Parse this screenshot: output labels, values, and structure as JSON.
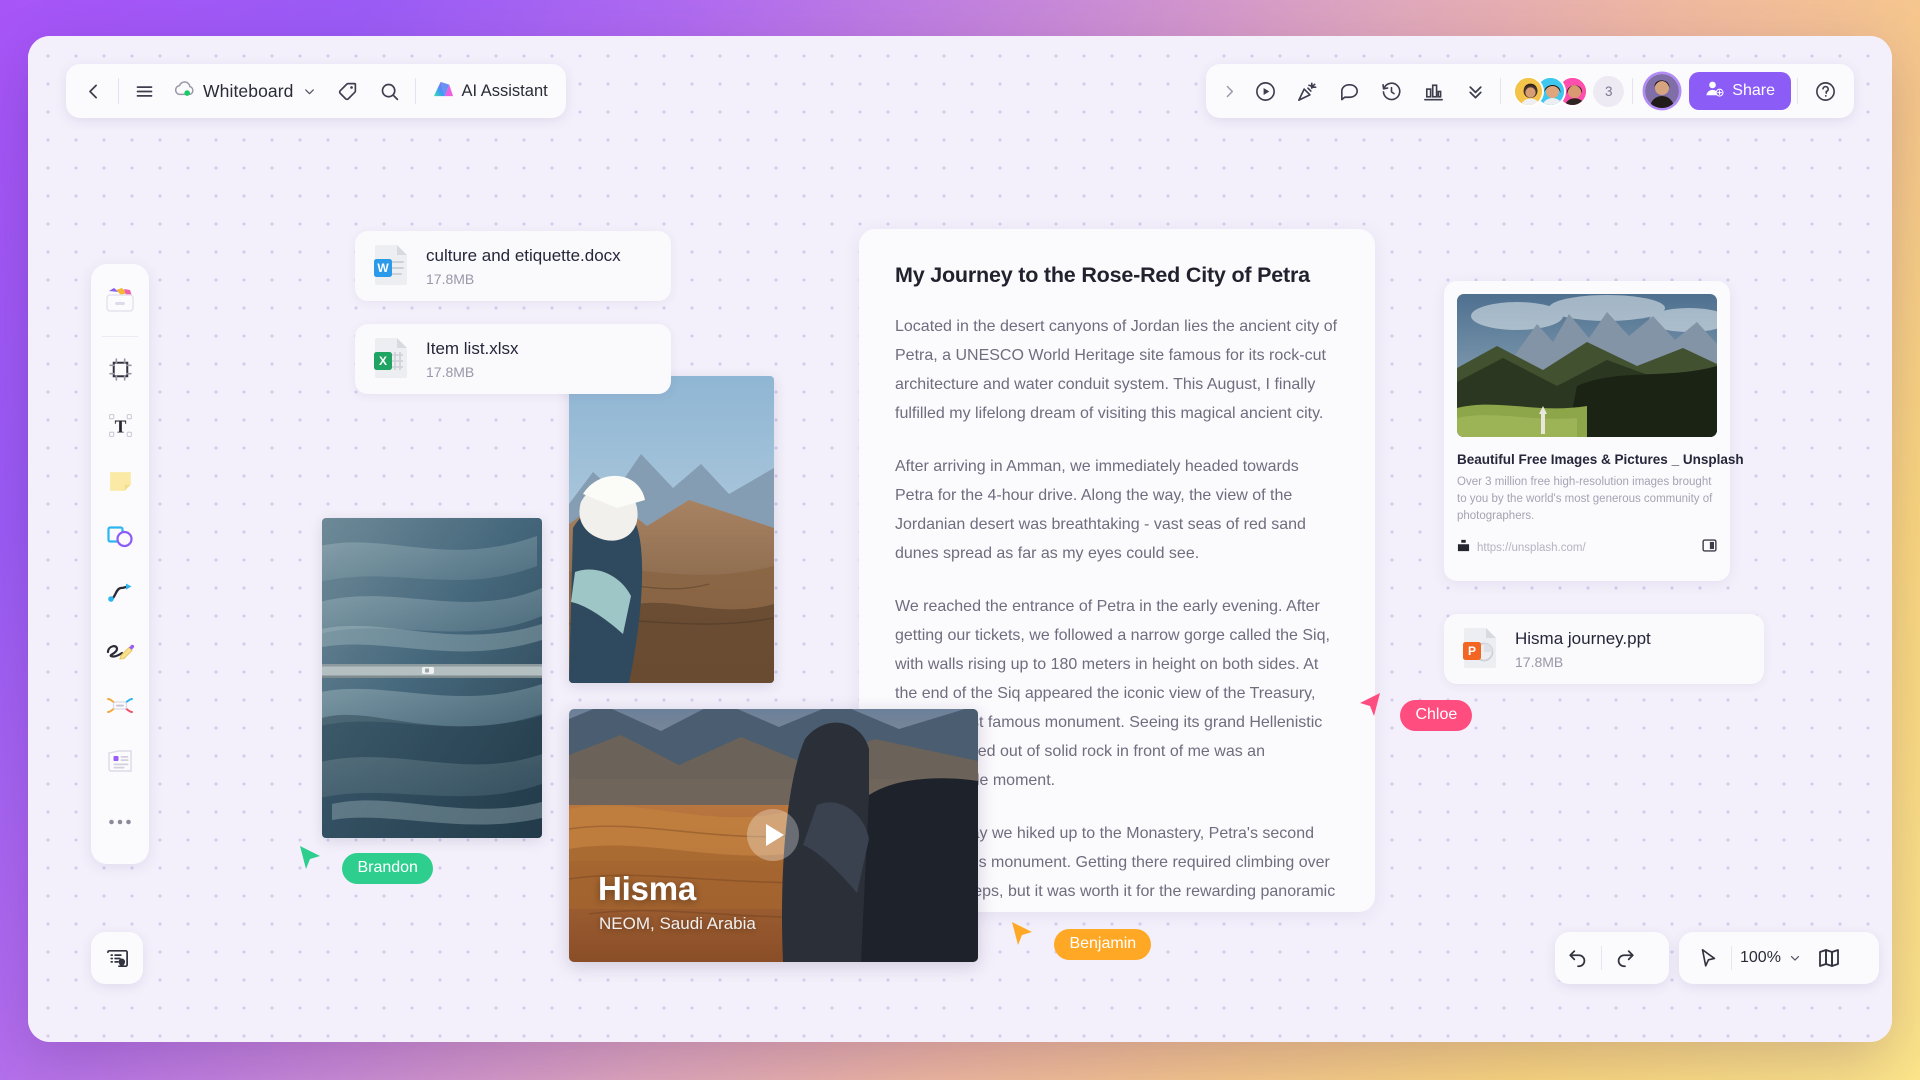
{
  "app": {
    "background_gradient": [
      "#a855f7",
      "#e0a8bd",
      "#fde68a"
    ],
    "canvas_bg": "#f3f0fb"
  },
  "topbar_left": {
    "back_icon": "chevron-left-icon",
    "menu_icon": "hamburger-menu-icon",
    "doc_icon": "cloud-synced-icon",
    "doc_title": "Whiteboard",
    "doc_caret": "chevron-down-icon",
    "tag_icon": "tag-icon",
    "search_icon": "search-icon",
    "ai_icon": "ai-sparkle-icon",
    "ai_label": "AI Assistant"
  },
  "topbar_right": {
    "expand_icon": "chevron-right-icon",
    "icons": [
      {
        "name": "present-play-icon"
      },
      {
        "name": "party-popper-icon"
      },
      {
        "name": "comment-bubble-icon"
      },
      {
        "name": "timer-icon"
      },
      {
        "name": "vote-chart-icon"
      },
      {
        "name": "chevron-double-down-icon"
      }
    ],
    "collaborators": [
      {
        "name": "collaborator-avatar-1",
        "ring": "#f5c242"
      },
      {
        "name": "collaborator-avatar-2",
        "ring": "#35c8f0"
      },
      {
        "name": "collaborator-avatar-3",
        "ring": "#ff3ea5"
      }
    ],
    "overflow_count": "3",
    "me_avatar": "current-user-avatar",
    "share_label": "Share",
    "share_icon": "add-person-icon",
    "share_color": "#8b5cf6",
    "help_icon": "help-circle-icon"
  },
  "tool_rail": [
    {
      "name": "tool-template-gallery",
      "icon": "template-tray-icon"
    },
    {
      "name": "tool-frame",
      "icon": "frame-icon"
    },
    {
      "name": "tool-text",
      "icon": "text-t-icon"
    },
    {
      "name": "tool-sticky-note",
      "icon": "sticky-note-icon"
    },
    {
      "name": "tool-shapes",
      "icon": "shapes-icon"
    },
    {
      "name": "tool-connector",
      "icon": "curve-arrow-icon"
    },
    {
      "name": "tool-pen",
      "icon": "pen-scribble-icon"
    },
    {
      "name": "tool-mindmap",
      "icon": "mindmap-icon"
    },
    {
      "name": "tool-document",
      "icon": "document-card-icon"
    },
    {
      "name": "tool-more",
      "icon": "more-dots-icon"
    }
  ],
  "canvas": {
    "file_cards": [
      {
        "name": "culture and etiquette.docx",
        "size": "17.8MB",
        "icon": "word-file-icon",
        "color": "#2b7cd3"
      },
      {
        "name": "Item list.xlsx",
        "size": "17.8MB",
        "icon": "excel-file-icon",
        "color": "#1fa463"
      },
      {
        "name": "Hisma journey.ppt",
        "size": "17.8MB",
        "icon": "powerpoint-file-icon",
        "color": "#f26522"
      }
    ],
    "document": {
      "heading": "My Journey to the Rose-Red City of Petra",
      "paragraphs": [
        "Located in the desert canyons of Jordan lies the ancient city of Petra, a UNESCO World Heritage site famous for its rock-cut architecture and water conduit system. This August, I finally fulfilled my lifelong dream of visiting this magical ancient city.",
        "After arriving in Amman, we immediately headed towards Petra for the 4-hour drive. Along the way, the view of the Jordanian desert was breathtaking - vast seas of red sand dunes spread as far as my eyes could see.",
        "We reached the entrance of Petra in the early evening. After getting our tickets, we followed a narrow gorge called the Siq, with walls rising up to 180 meters in height on both sides. At the end of the Siq appeared the iconic view of the Treasury, Petra's most famous monument. Seeing its grand Hellenistic facade carved out of solid rock in front of me was an unforgettable moment.",
        "The next day we hiked up to the Monastery, Petra's second most famous monument. Getting there required climbing over 900 rock steps, but it was worth it for the rewarding panoramic view at the summit. Beyond the Monastery was an expansive High Place of Sacrifice used for religious rituals during Nabataean times."
      ]
    },
    "link_card": {
      "title": "Beautiful Free Images & Pictures _ Unsplash",
      "description": "Over 3 million free high-resolution images brought to you by the world's most generous community of photographers.",
      "url": "https://unsplash.com/",
      "favicon": "unsplash-favicon-icon",
      "action_icon": "open-preview-icon"
    },
    "video": {
      "title": "Hisma",
      "subtitle": "NEOM, Saudi Arabia",
      "play_icon": "play-triangle-icon"
    },
    "images": [
      {
        "name": "aerial-road-photo"
      },
      {
        "name": "desert-hiker-photo"
      }
    ],
    "cursors": [
      {
        "label": "Brandon",
        "color": "#2ecf8e"
      },
      {
        "label": "Benjamin",
        "color": "#ffa826"
      },
      {
        "label": "Chloe",
        "color": "#ff4d80"
      }
    ]
  },
  "bottom_bar": {
    "locate_icon": "card-location-icon",
    "undo_icon": "undo-arrow-icon",
    "redo_icon": "redo-arrow-icon",
    "pointer_icon": "pointer-cursor-icon",
    "zoom_level": "100%",
    "zoom_caret": "chevron-down-icon",
    "minimap_icon": "minimap-book-icon"
  }
}
